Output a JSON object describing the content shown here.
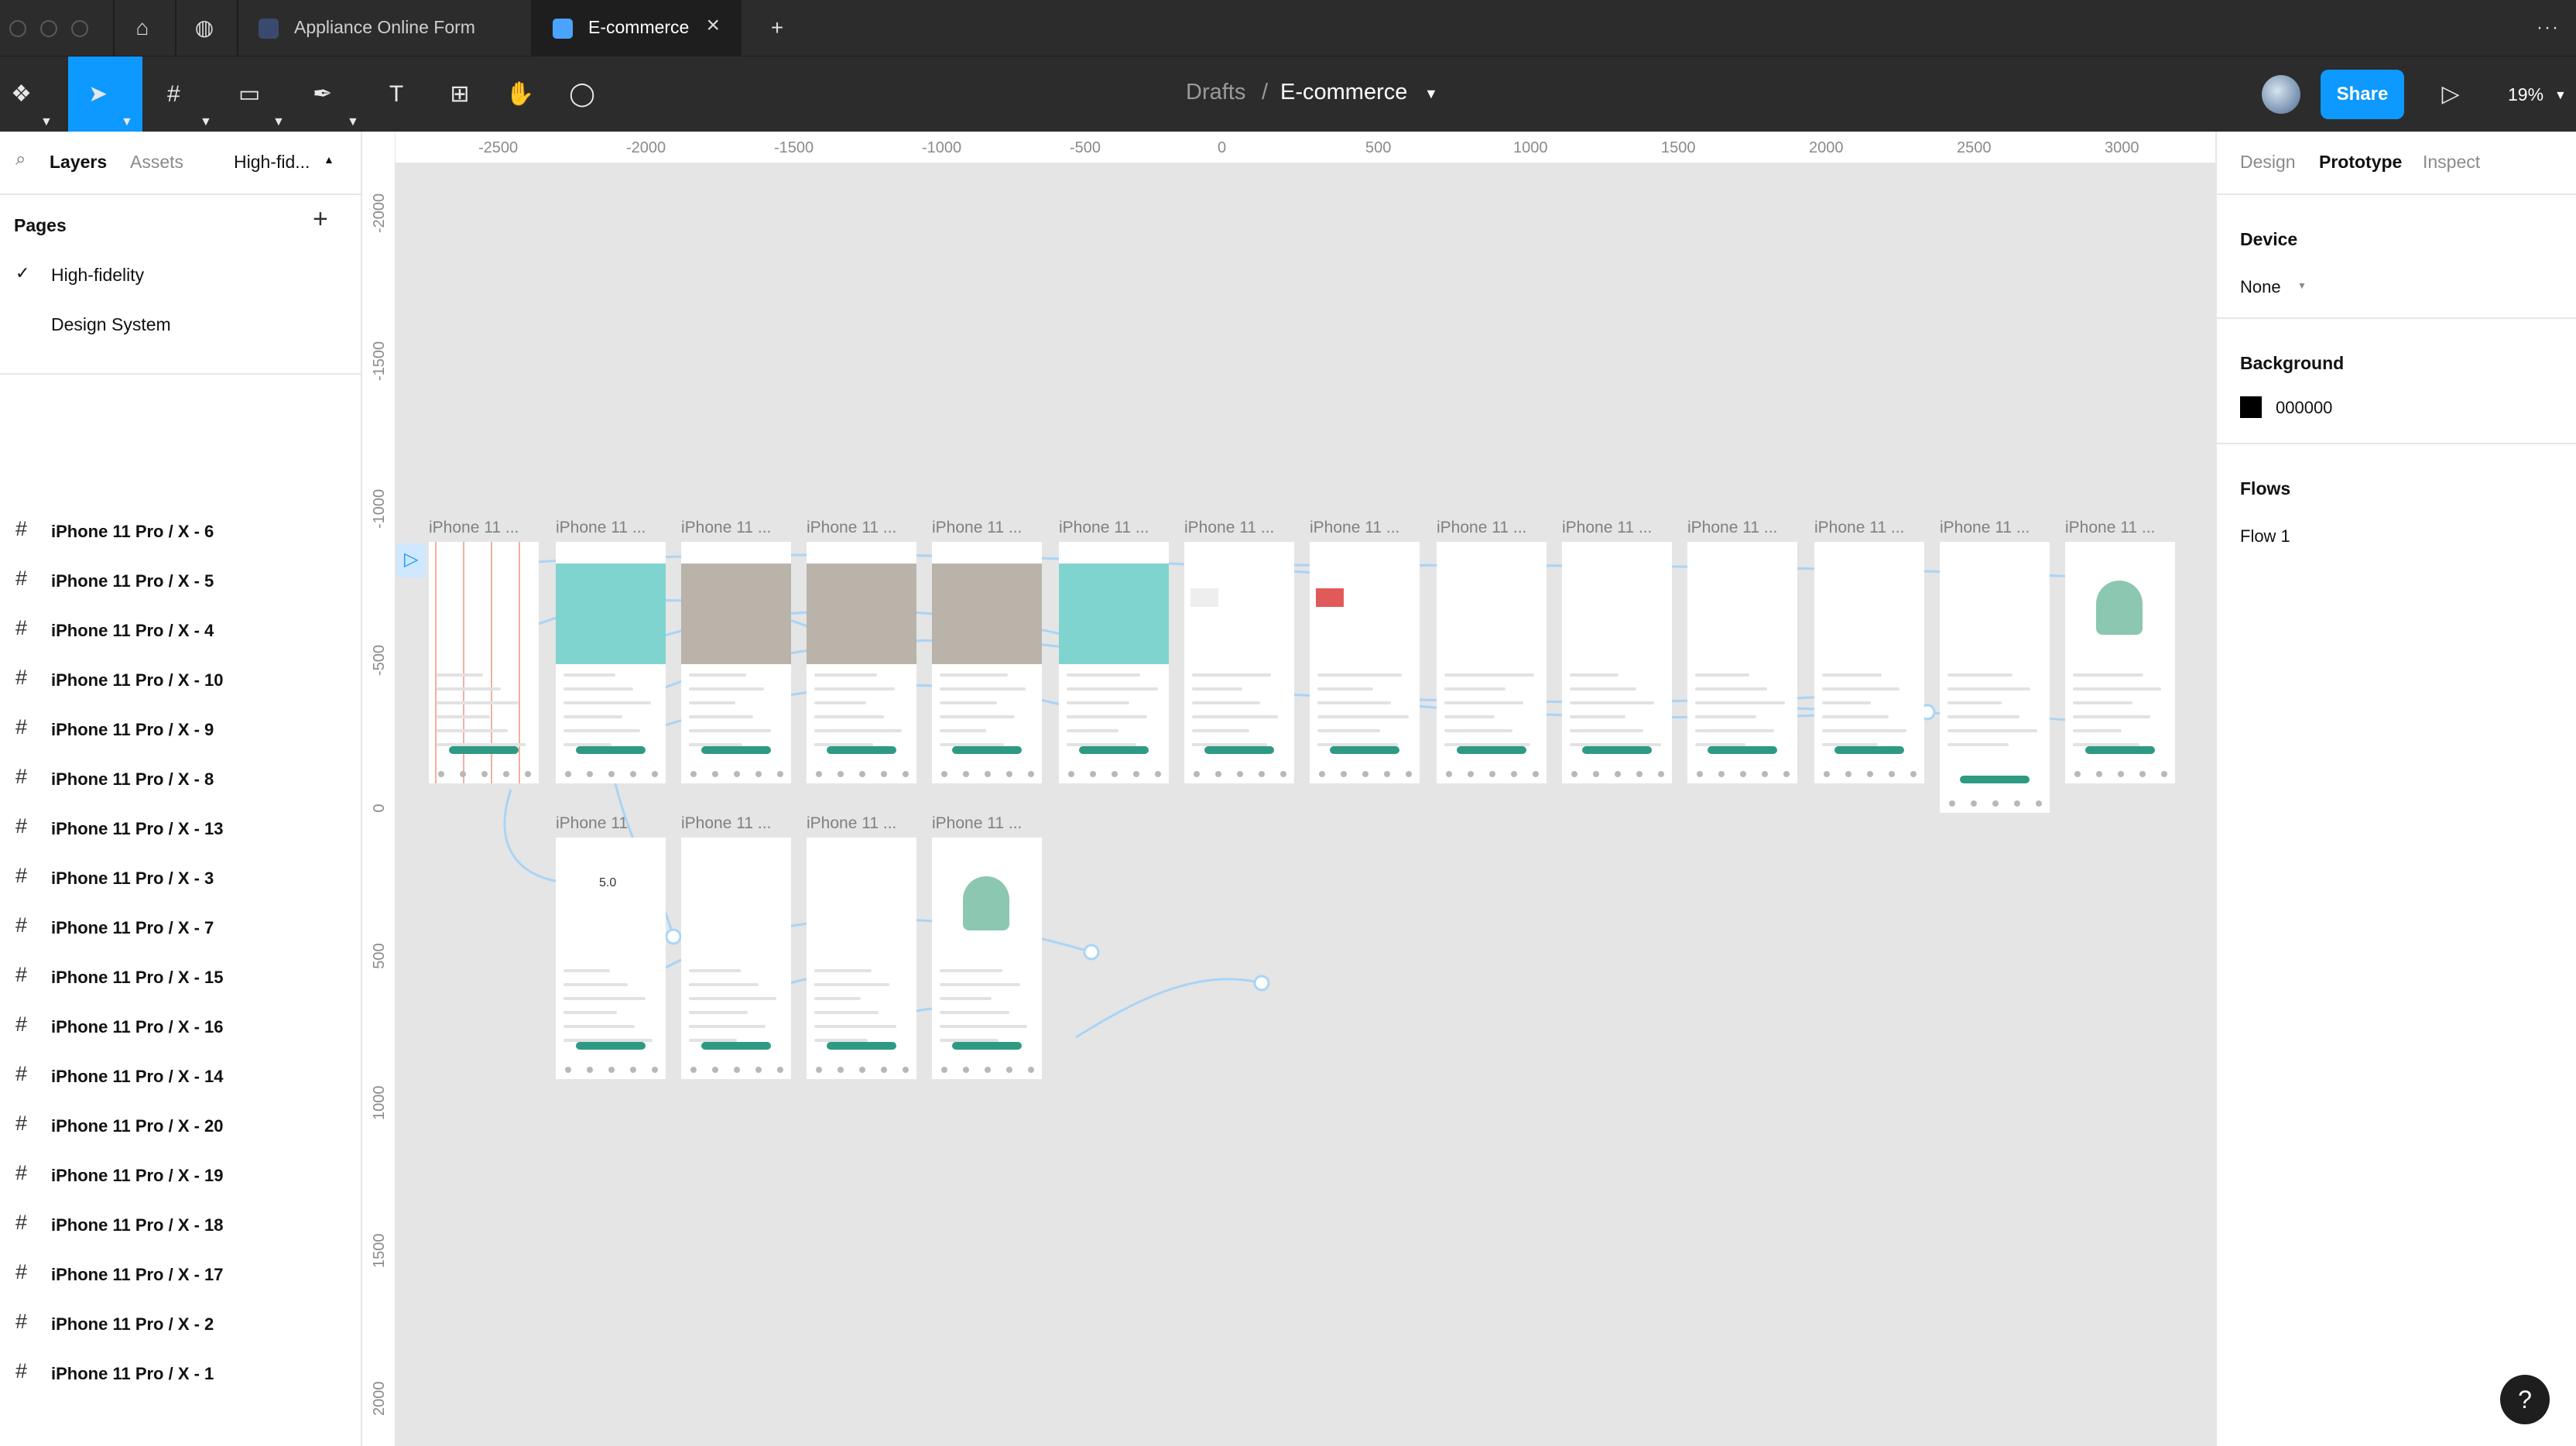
{
  "tabs": {
    "tab1": {
      "label": "Appliance Online Form"
    },
    "tab2": {
      "label": "E-commerce"
    }
  },
  "toolbar": {
    "crumb_root": "Drafts",
    "crumb_sep": "/",
    "file_name": "E-commerce",
    "share_label": "Share",
    "zoom": "19%"
  },
  "left_panel": {
    "tab_layers": "Layers",
    "tab_assets": "Assets",
    "page_dropdown": "High-fid...",
    "pages_title": "Pages",
    "pages": [
      "High-fidelity",
      "Design System"
    ],
    "layers": [
      "iPhone 11 Pro / X - 6",
      "iPhone 11 Pro / X - 5",
      "iPhone 11 Pro / X - 4",
      "iPhone 11 Pro / X - 10",
      "iPhone 11 Pro / X - 9",
      "iPhone 11 Pro / X - 8",
      "iPhone 11 Pro / X - 13",
      "iPhone 11 Pro / X - 3",
      "iPhone 11 Pro / X - 7",
      "iPhone 11 Pro / X - 15",
      "iPhone 11 Pro / X - 16",
      "iPhone 11 Pro / X - 14",
      "iPhone 11 Pro / X - 20",
      "iPhone 11 Pro / X - 19",
      "iPhone 11 Pro / X - 18",
      "iPhone 11 Pro / X - 17",
      "iPhone 11 Pro / X - 2",
      "iPhone 11 Pro / X - 1"
    ]
  },
  "right_panel": {
    "tab_design": "Design",
    "tab_prototype": "Prototype",
    "tab_inspect": "Inspect",
    "device_title": "Device",
    "device_value": "None",
    "background_title": "Background",
    "background_hex": "000000",
    "flows_title": "Flows",
    "flow_name": "Flow 1"
  },
  "rulers": {
    "top": [
      "-2500",
      "-2000",
      "-1500",
      "-1000",
      "-500",
      "0",
      "500",
      "1000",
      "1500",
      "2000",
      "2500",
      "3000"
    ],
    "left": [
      "-2000",
      "-1500",
      "-1000",
      "-500",
      "0",
      "500",
      "1000",
      "1500",
      "2000"
    ]
  },
  "canvas": {
    "frame_label": "iPhone 11 ...",
    "frame_label_partial": "iPhone 11",
    "review_score": "5.0"
  },
  "colors": {
    "accent": "#0d99ff",
    "dark_chrome": "#2c2c2c",
    "canvas_bg": "#e5e5e5",
    "teal_brand": "#2f9a84",
    "product_teal": "#7fd4cf"
  },
  "icons": {
    "help": "?"
  }
}
